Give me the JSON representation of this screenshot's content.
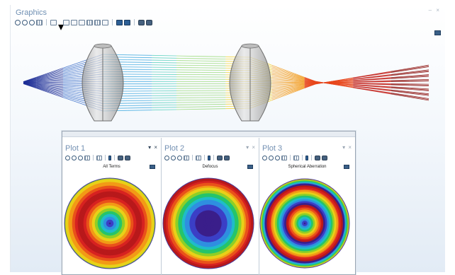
{
  "graphics": {
    "title": "Graphics",
    "window_buttons": "– ×",
    "toolbar_icons": [
      "zoom-in-icon",
      "zoom-out-icon",
      "zoom-box-icon",
      "zoom-extents-icon",
      "arrow-tool-icon",
      "dropdown-icon",
      "view-xy-icon",
      "view-yz-icon",
      "view-zx-icon",
      "grid-icon",
      "frame-icon",
      "panel-icon",
      "render-icon",
      "wireframe-icon",
      "camera-icon",
      "print-icon"
    ],
    "ray_colors": [
      "#1e2f96",
      "#2a61c4",
      "#33a3dd",
      "#4ecdb9",
      "#8fd66b",
      "#f2d01f",
      "#f29a1a",
      "#e8461c",
      "#c21d16",
      "#8e130f"
    ]
  },
  "plots": [
    {
      "title": "Plot 1",
      "window_buttons": "▾ ×",
      "active": true,
      "subtitle": "All Terms"
    },
    {
      "title": "Plot 2",
      "window_buttons": "▾ ×",
      "active": false,
      "subtitle": "Defocus"
    },
    {
      "title": "Plot 3",
      "window_buttons": "▾ ×",
      "active": false,
      "subtitle": "Spherical Aberration"
    }
  ],
  "rainbow": [
    "#3a1e8a",
    "#3b3fc6",
    "#2f8fe0",
    "#1fbcc9",
    "#25c46b",
    "#8fcf27",
    "#e9d018",
    "#f29a16",
    "#e9521a",
    "#d72220",
    "#b8191b"
  ]
}
